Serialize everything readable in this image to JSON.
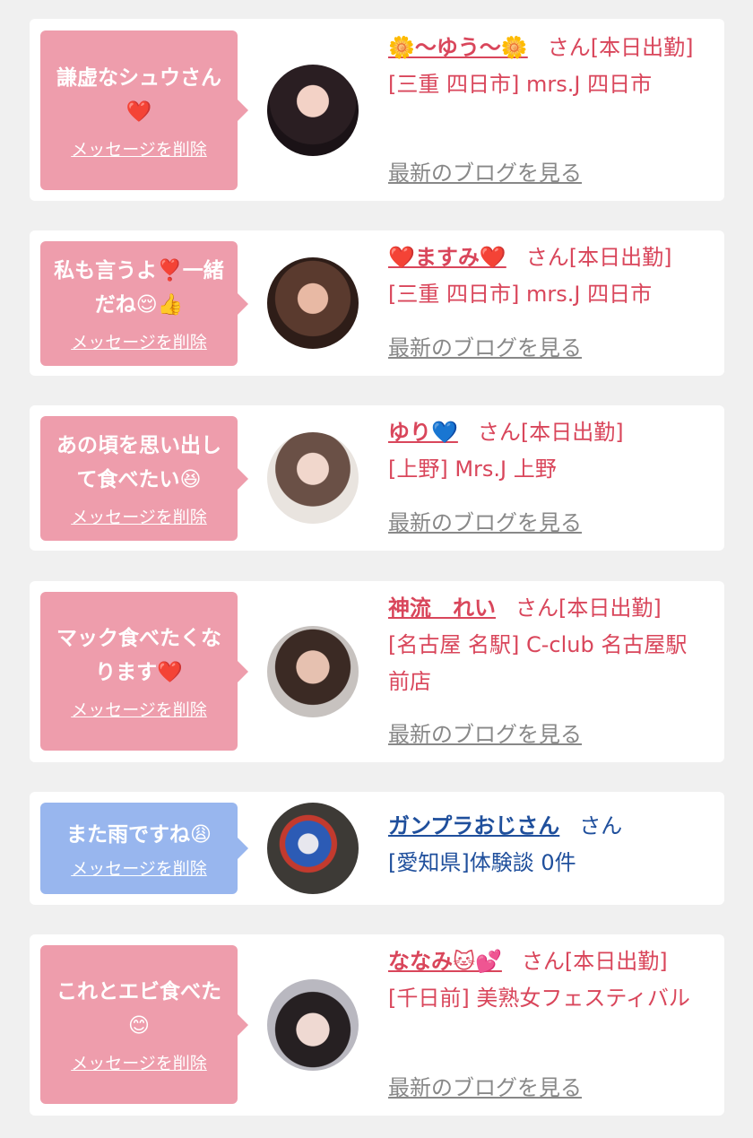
{
  "delete_label": "メッセージを削除",
  "blog_label": "最新のブログを見る",
  "cards": [
    {
      "message": "謙虚なシュウさん❤️",
      "name": "🌼〜ゆう〜🌼",
      "suffix": "さん[本日出勤]",
      "location": "[三重 四日市] mrs.J 四日市",
      "bubble_color": "#ee9dac"
    },
    {
      "message": "私も言うよ❣️一緒だね😌👍",
      "name": "❤️ますみ❤️",
      "suffix": "さん[本日出勤]",
      "location": "[三重 四日市] mrs.J 四日市",
      "bubble_color": "#ee9dac"
    },
    {
      "message": "あの頃を思い出して食べたい😆",
      "name": "ゆり💙",
      "suffix": "さん[本日出勤]",
      "location": "[上野] Mrs.J 上野",
      "bubble_color": "#ee9dac"
    },
    {
      "message": "マック食べたくなります❤️",
      "name": "神流　れい",
      "suffix": "さん[本日出勤]",
      "location": "[名古屋 名駅] C-club 名古屋駅前店",
      "bubble_color": "#ee9dac"
    },
    {
      "message": "また雨ですね😩",
      "name": "ガンプラおじさん",
      "suffix": "さん",
      "location": "[愛知県]体験談 0件",
      "bubble_color": "#98b6ee"
    },
    {
      "message": "これとエビ食べた😊",
      "name": "ななみ🐱💕",
      "suffix": "さん[本日出勤]",
      "location": "[千日前] 美熟女フェスティバル",
      "bubble_color": "#ee9dac"
    }
  ]
}
